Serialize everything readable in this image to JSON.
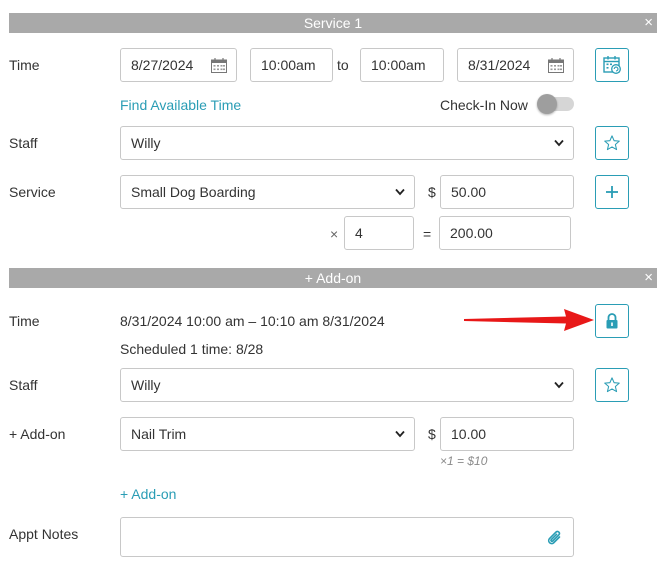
{
  "service_section": {
    "title": "Service 1",
    "close": "×",
    "time_label": "Time",
    "start_date": "8/27/2024",
    "start_time": "10:00am",
    "to": "to",
    "end_time": "10:00am",
    "end_date": "8/31/2024",
    "find_time_link": "Find Available Time",
    "check_in_label": "Check-In Now",
    "check_in_on": false,
    "staff_label": "Staff",
    "staff_value": "Willy",
    "service_label": "Service",
    "service_value": "Small Dog Boarding",
    "currency": "$",
    "price": "50.00",
    "plus_icon": "+",
    "multiply": "×",
    "quantity": "4",
    "equals": "=",
    "total": "200.00"
  },
  "addon_section": {
    "title": "+ Add-on",
    "close": "×",
    "time_label": "Time",
    "time_range": "8/31/2024 10:00 am – 10:10 am 8/31/2024",
    "scheduled": "Scheduled 1 time: 8/28",
    "staff_label": "Staff",
    "staff_value": "Willy",
    "addon_label": "+ Add-on",
    "addon_value": "Nail Trim",
    "currency": "$",
    "price": "10.00",
    "price_hint": "×1 = $10",
    "add_addon_link": "+ Add-on",
    "notes_label": "Appt Notes",
    "notes_value": ""
  },
  "colors": {
    "accent": "#2a9db5",
    "section_bar": "#a9a9a9",
    "arrow": "#e81818"
  },
  "icons": {
    "calendar": "calendar-icon",
    "calendar_refresh": "calendar-refresh-icon",
    "star": "star-icon",
    "plus": "plus-icon",
    "lock": "lock-icon",
    "paperclip": "paperclip-icon"
  }
}
